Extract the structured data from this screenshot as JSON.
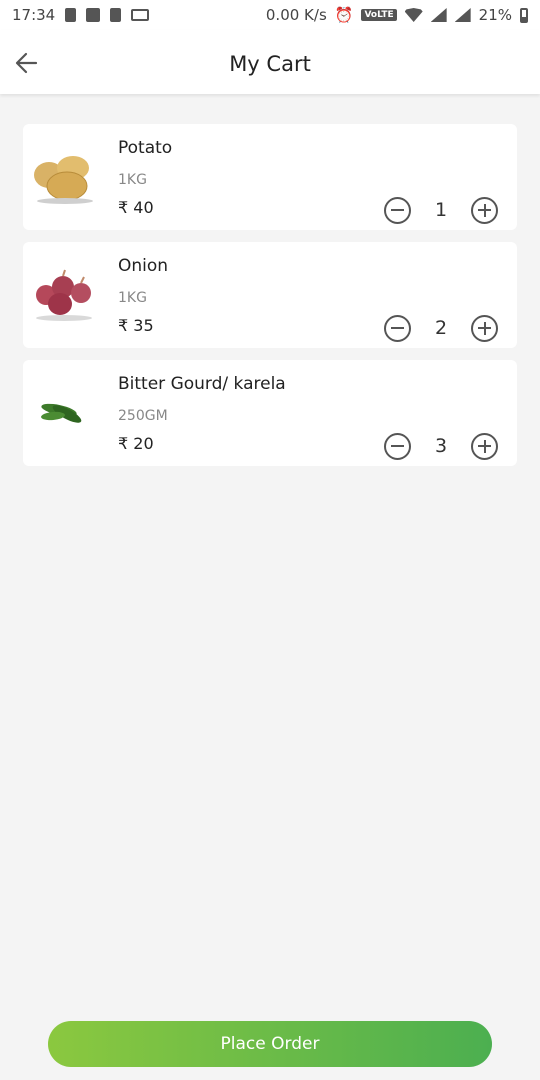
{
  "status_bar": {
    "time": "17:34",
    "network_speed": "0.00 K/s",
    "volte_label": "VoLTE",
    "battery_percent": "21%",
    "icons": [
      "battery-saver-icon",
      "image-icon",
      "sim-icon",
      "laptop-icon",
      "alarm-icon",
      "volte-icon",
      "wifi-icon",
      "signal-icon",
      "signal-icon",
      "battery-icon"
    ]
  },
  "header": {
    "title": "My Cart",
    "back_icon": "arrow-left-icon"
  },
  "cart": {
    "items": [
      {
        "name": "Potato",
        "unit": "1KG",
        "price": "₹ 40",
        "qty": "1",
        "image": "potato"
      },
      {
        "name": "Onion",
        "unit": "1KG",
        "price": "₹ 35",
        "qty": "2",
        "image": "onion"
      },
      {
        "name": "Bitter Gourd/ karela",
        "unit": "250GM",
        "price": "₹ 20",
        "qty": "3",
        "image": "bitter-gourd"
      }
    ]
  },
  "footer": {
    "place_order_label": "Place Order"
  },
  "colors": {
    "accent_start": "#8bc83f",
    "accent_end": "#4caf50",
    "background": "#f4f4f4",
    "card": "#ffffff"
  }
}
